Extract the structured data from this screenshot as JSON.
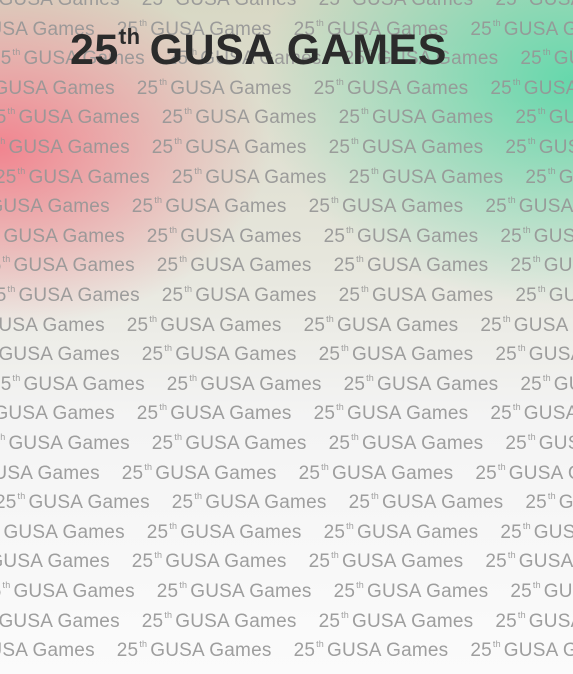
{
  "title": {
    "number": "25",
    "suffix": "th",
    "text": "GUSA GAMES"
  },
  "pattern": {
    "number": "25",
    "suffix": "th",
    "text": "GUSA Games"
  }
}
